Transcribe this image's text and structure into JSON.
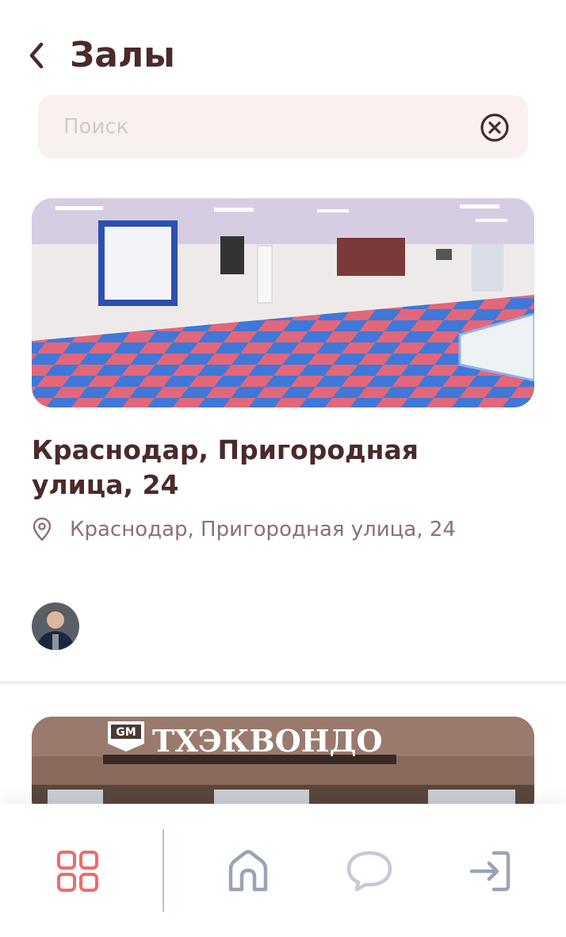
{
  "header": {
    "title": "Залы",
    "back_icon": "chevron-left-icon"
  },
  "search": {
    "placeholder": "Поиск",
    "value": "",
    "clear_icon": "close-circle-icon"
  },
  "gyms": [
    {
      "title": "Краснодар, Пригородная улица, 24",
      "address": "Краснодар, Пригородная улица, 24",
      "address_icon": "map-pin-icon",
      "image": "gym-hall-photo",
      "trainer_avatar": "trainer-avatar"
    },
    {
      "image": "gym-building-photo",
      "sign_text": "ТХЭКВОНДО",
      "logo_text": "GM"
    }
  ],
  "tabbar": {
    "items": [
      {
        "name": "grid-icon",
        "active": true
      },
      {
        "name": "home-icon",
        "active": false
      },
      {
        "name": "chat-icon",
        "active": false
      },
      {
        "name": "login-icon",
        "active": false
      }
    ],
    "colors": {
      "active": "#f26a6a",
      "inactive": "#9aa3b8",
      "chat": "#c4cad8"
    }
  },
  "colors": {
    "text_primary": "#4a2a2a",
    "text_secondary": "#8e7070",
    "search_bg": "#f8f1f0"
  }
}
